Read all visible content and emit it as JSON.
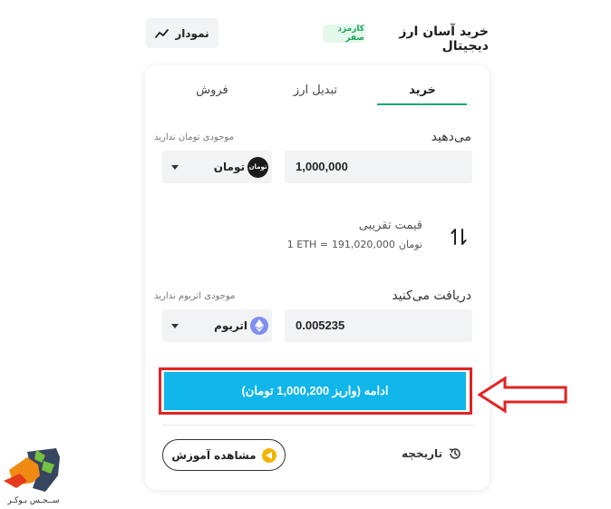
{
  "header": {
    "title": "خرید آسان ارز دیجیتال",
    "badge": "کارمزد صفر",
    "chart_button": "نمودار"
  },
  "tabs": [
    {
      "label": "خرید",
      "active": true
    },
    {
      "label": "تبدیل ارز",
      "active": false
    },
    {
      "label": "فروش",
      "active": false
    }
  ],
  "pay": {
    "label": "می‌دهید",
    "hint": "موجودی تومان ندارید",
    "amount": "1,000,000",
    "currency": "تومان",
    "currency_icon_text": "تومان"
  },
  "rate": {
    "label": "قیمت تقریبی",
    "value": "191,020,000",
    "unit": "تومان",
    "prefix": "1 ETH ="
  },
  "receive": {
    "label": "دریافت می‌کنید",
    "hint": "موجودی اتریوم ندارید",
    "amount": "0.005235",
    "currency": "اتریوم"
  },
  "cta": {
    "label": "ادامه (واریز 1,000,200 تومان)"
  },
  "footer": {
    "tutorial": "مشاهده آموزش",
    "history": "تاریخچه"
  },
  "watermark": {
    "text": "ســجـس بـوکـر"
  },
  "colors": {
    "accent_green": "#1ca77b",
    "cta_blue": "#10b5ea",
    "annotation_red": "#e02424",
    "play_yellow": "#f5b300"
  },
  "icons": [
    "chart-line-icon",
    "swap-arrows-icon",
    "toman-coin-icon",
    "ethereum-icon",
    "history-icon",
    "play-icon",
    "caret-down-icon"
  ]
}
